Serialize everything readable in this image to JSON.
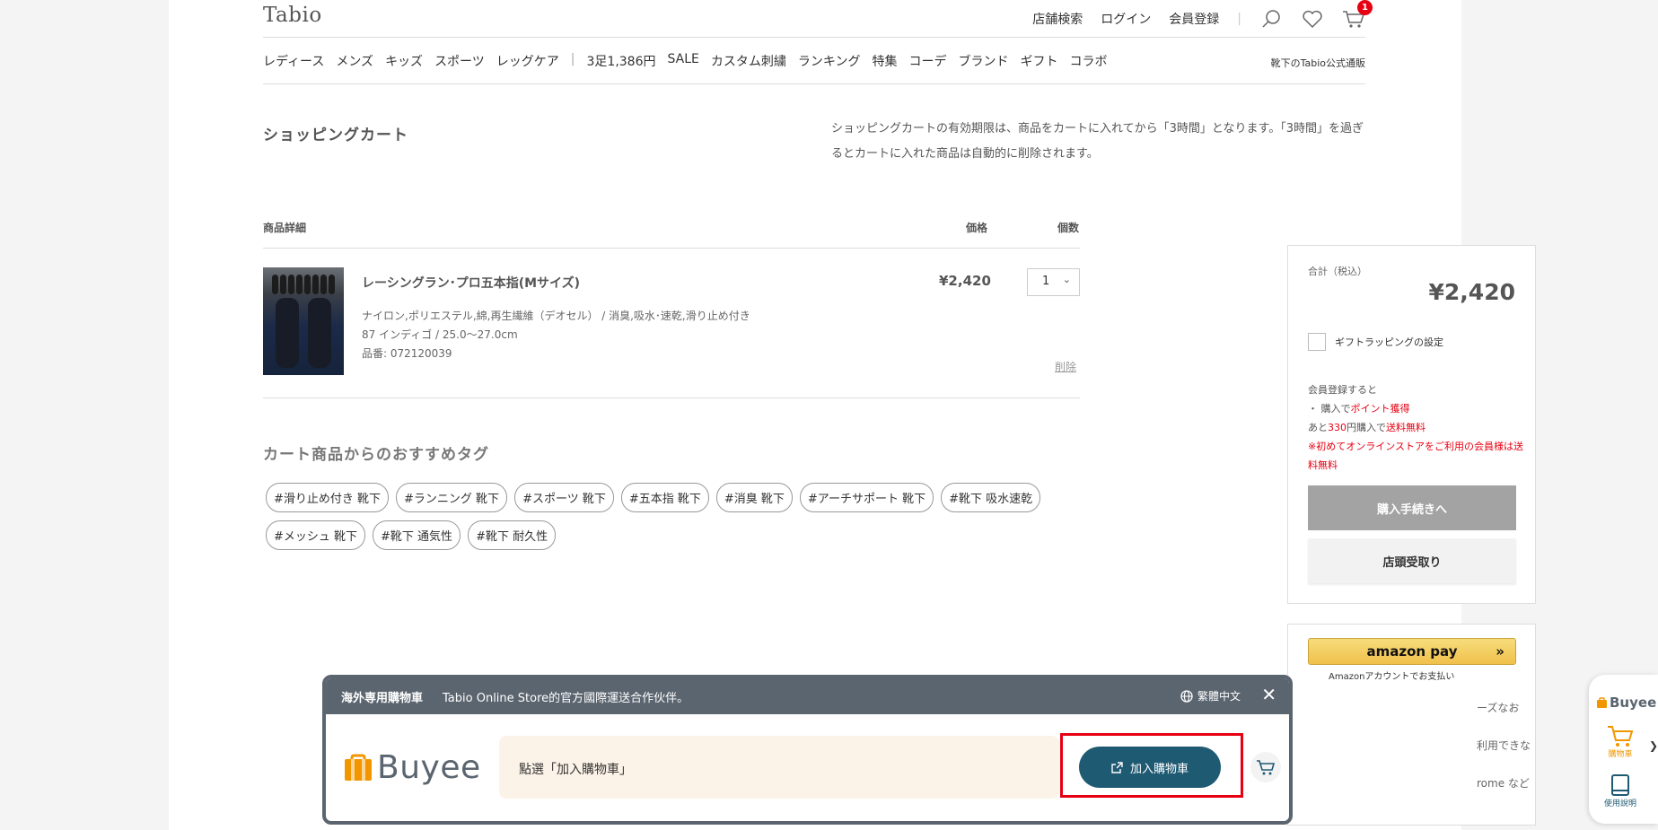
{
  "header": {
    "logo": "Tabio",
    "util_links": [
      "店舗検索",
      "ログイン",
      "会員登録"
    ],
    "cart_count": "1",
    "nav": [
      "レディース",
      "メンズ",
      "キッズ",
      "スポーツ",
      "レッグケア"
    ],
    "nav2": [
      "3足1,386円",
      "SALE",
      "カスタム刺繍",
      "ランキング",
      "特集",
      "コーデ",
      "ブランド",
      "ギフト",
      "コラボ"
    ],
    "tagline": "靴下のTabio公式通販"
  },
  "cart": {
    "title": "ショッピングカート",
    "notice": "ショッピングカートの有効期限は、商品をカートに入れてから「3時間」となります。「3時間」を過ぎるとカートに入れた商品は自動的に削除されます。",
    "col_detail": "商品詳細",
    "col_price": "価格",
    "col_qty": "個数",
    "item": {
      "name": "レーシングラン･プロ五本指(Mサイズ)",
      "material": "ナイロン,ポリエステル,綿,再生繊維（デオセル） / 消臭,吸水･速乾,滑り止め付き",
      "color_size": "87 インディゴ / 25.0〜27.0cm",
      "sku": "品番: 072120039",
      "price": "¥2,420",
      "qty": "1",
      "delete": "削除"
    },
    "rec_title": "カート商品からのおすすめタグ",
    "tags": [
      "#滑り止め付き 靴下",
      "#ランニング 靴下",
      "#スポーツ 靴下",
      "#五本指 靴下",
      "#消臭 靴下",
      "#アーチサポート 靴下",
      "#靴下 吸水速乾",
      "#メッシュ 靴下",
      "#靴下 通気性",
      "#靴下 耐久性"
    ]
  },
  "summary": {
    "total_label": "合計（税込）",
    "total": "¥2,420",
    "gift": "ギフトラッピングの設定",
    "member_intro": "会員登録すると",
    "member_line1_pre": "・ 購入で",
    "member_line1_red": "ポイント獲得",
    "member_line2_pre": "あと",
    "member_line2_red1": "330",
    "member_line2_mid": "円購入で",
    "member_line2_red2": "送料無料",
    "member_line3": "※初めてオンラインストアをご利用の会員様は送料無料",
    "checkout": "購入手続きへ",
    "store_pickup": "店頭受取り",
    "amazon": "amazon pay",
    "amazon_sub": "Amazonアカウントでお支払い",
    "partial_lines": [
      "ーズなお",
      "利用できな",
      "rome など"
    ]
  },
  "buyee": {
    "head_title": "海外専用購物車",
    "head_desc": "Tabio Online Store的官方國際運送合作伙伴。",
    "lang": "繁體中文",
    "logo": "Buyee",
    "hint": "點選「加入購物車」",
    "add_cart": "加入購物車"
  },
  "side_widget": {
    "logo": "Buyee",
    "cart_label": "購物車",
    "guide_label": "使用說明"
  },
  "colors": {
    "buyee_gray": "#5b656f",
    "buyee_orange": "#f29600",
    "buyee_button": "#1f5a73",
    "highlight": "#e60012"
  }
}
